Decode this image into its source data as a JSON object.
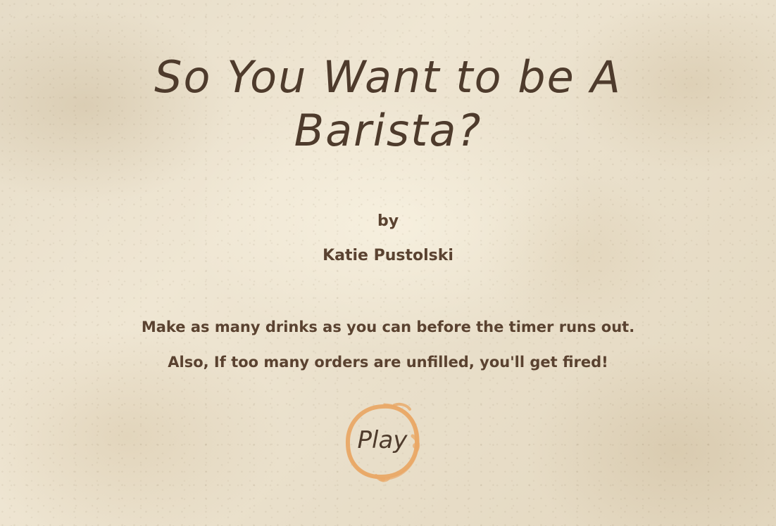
{
  "game": {
    "title": "So You Want to be A Barista?",
    "by_label": "by",
    "author": "Katie Pustolski",
    "instructions": [
      "Make as many drinks as you can before the timer runs out.",
      "Also, If too many orders are unfilled, you'll get fired!"
    ],
    "play_label": "Play"
  },
  "colors": {
    "text": "#5a4230",
    "title": "#4e3b2c",
    "coffee_ring": "#e9a866",
    "background": "#ebe1cc"
  }
}
